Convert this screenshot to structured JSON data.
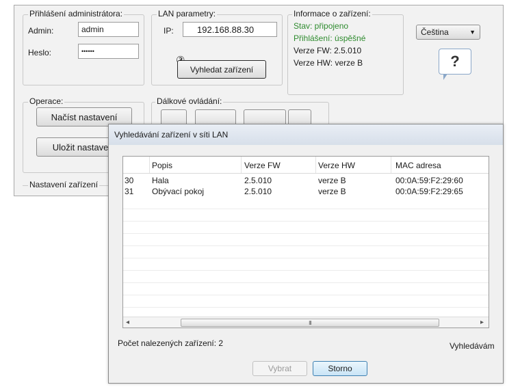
{
  "admin_login": {
    "title": "Přihlášení administrátora:",
    "admin_label": "Admin:",
    "admin_value": "admin",
    "password_label": "Heslo:",
    "password_value": "••••••"
  },
  "lan": {
    "title": "LAN parametry:",
    "ip_label": "IP:",
    "ip_value": "192.168.88.30",
    "callout": "③",
    "search_button": "Vyhledat zařízení"
  },
  "device_info": {
    "title": "Informace o zařízení:",
    "status": "Stav: připojeno",
    "login": "Přihlášení: úspěšné",
    "fw": "Verze FW: 2.5.010",
    "hw": "Verze HW: verze B"
  },
  "language": {
    "selected": "Čeština",
    "help_glyph": "?"
  },
  "operations": {
    "title": "Operace:",
    "load_button": "Načíst nastavení",
    "save_button": "Uložit nastavení"
  },
  "remote": {
    "title": "Dálkové ovládání:"
  },
  "device_settings": {
    "title": "Nastavení zařízení"
  },
  "dialog": {
    "title": "Vyhledávání zařízení v síti LAN",
    "columns": [
      "",
      "Popis",
      "Verze FW",
      "Verze HW",
      "MAC adresa"
    ],
    "rows": [
      [
        "30",
        "Hala",
        "2.5.010",
        "verze B",
        "00:0A:59:F2:29:60"
      ],
      [
        "31",
        "Obývací pokoj",
        "2.5.010",
        "verze B",
        "00:0A:59:F2:29:65"
      ]
    ],
    "scroll_left": "◂",
    "scroll_right": "▸",
    "scroll_grip": "III",
    "found_count": "Počet nalezených zařízení: 2",
    "status": "Vyhledávám",
    "select_button": "Vybrat",
    "cancel_button": "Storno"
  }
}
